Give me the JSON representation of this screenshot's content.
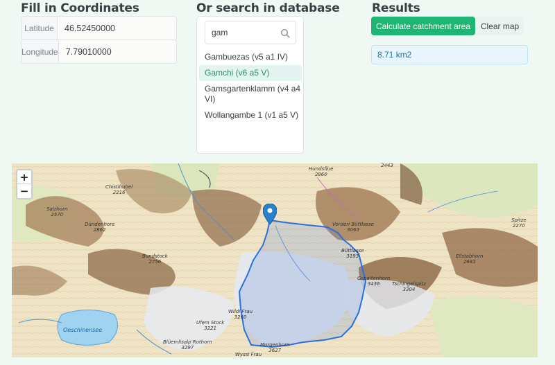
{
  "coordinates": {
    "title": "Fill in Coordinates",
    "latitude_label": "Latitude",
    "latitude_value": "46.52450000",
    "longitude_label": "Longitude",
    "longitude_value": "7.79010000"
  },
  "search": {
    "title": "Or search in database",
    "query": "gam",
    "icon": "search-icon",
    "results": [
      "Gambuezas (v5 a1 IV)",
      "Gamchi (v6 a5 V)",
      "Gamsgartenklamm (v4 a4 VI)",
      "Wollangambe 1 (v1 a5 V)"
    ],
    "selected": "Gamchi (v6 a5 V)"
  },
  "results": {
    "title": "Results",
    "calculate_label": "Calculate catchment area",
    "clear_label": "Clear map",
    "area": "8.71 km2"
  },
  "map": {
    "zoom_in": "+",
    "zoom_out": "−",
    "labels": [
      {
        "name": "Hundsflue",
        "elev": "2860"
      },
      {
        "name": "Chistihubel",
        "elev": "2216"
      },
      {
        "name": "Salzhorn",
        "elev": "2570"
      },
      {
        "name": "Dündenhore",
        "elev": "2862"
      },
      {
        "name": "Bundstock",
        "elev": "2756"
      },
      {
        "name": "Vorderi Büttlasse",
        "elev": "3063"
      },
      {
        "name": "Büttlasse",
        "elev": "3193"
      },
      {
        "name": "Ellstabhorn",
        "elev": "2683"
      },
      {
        "name": "Gspaltenhorn",
        "elev": "3436"
      },
      {
        "name": "Tschingelspitz",
        "elev": "3304"
      },
      {
        "name": "Wildi Frau",
        "elev": "3260"
      },
      {
        "name": "Ufem Stock",
        "elev": "3221"
      },
      {
        "name": "Blüemlisalp Rothorn",
        "elev": "3297"
      },
      {
        "name": "Morgenhorn",
        "elev": "3627"
      },
      {
        "name": "Wyssi Frau",
        "elev": ""
      },
      {
        "name": "Spitze",
        "elev": "2270"
      }
    ],
    "lake": "Oeschinensee",
    "extra_elevs": [
      "2443"
    ],
    "colors": {
      "catchment": "#2a6fe0",
      "marker": "#2a81cb",
      "accent": "#1fb573"
    }
  }
}
